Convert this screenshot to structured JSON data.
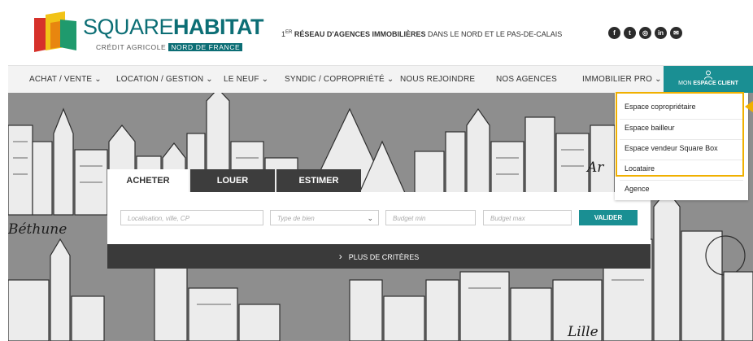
{
  "brand": {
    "name_part1": "SQUARE",
    "name_part2": "HABITAT",
    "sub_part1": "CRÉDIT AGRICOLE",
    "sub_part2": "NORD DE FRANCE"
  },
  "tagline": {
    "prefix": "1",
    "sup": "ER",
    "bold": " RÉSEAU D'AGENCES IMMOBILIÈRES",
    "rest": " DANS LE NORD ET LE PAS-DE-CALAIS"
  },
  "socials": [
    {
      "icon": "facebook-icon",
      "glyph": "f"
    },
    {
      "icon": "twitter-icon",
      "glyph": "t"
    },
    {
      "icon": "instagram-icon",
      "glyph": "◎"
    },
    {
      "icon": "linkedin-icon",
      "glyph": "in"
    },
    {
      "icon": "mail-icon",
      "glyph": "✉"
    }
  ],
  "nav": {
    "items": [
      "ACHAT / VENTE ⌄",
      "LOCATION / GESTION ⌄",
      "LE NEUF ⌄",
      "SYNDIC / COPROPRIÉTÉ ⌄",
      "NOUS REJOINDRE",
      "NOS AGENCES",
      "IMMOBILIER PRO ⌄"
    ],
    "client_prefix": "MON ",
    "client_bold": "ESPACE CLIENT"
  },
  "cities": [
    "Béthune",
    "Lille",
    "Ar"
  ],
  "search": {
    "tabs": [
      "ACHETER",
      "LOUER",
      "ESTIMER"
    ],
    "location_placeholder": "Localisation, ville, CP",
    "type_placeholder": "Type de bien",
    "budget_min_placeholder": "Budget min",
    "budget_max_placeholder": "Budget max",
    "submit_label": "VALIDER",
    "more_criteria": "PLUS DE CRITÈRES"
  },
  "dropdown": {
    "items": [
      "Espace copropriétaire",
      "Espace bailleur",
      "Espace vendeur Square Box",
      "Locataire",
      "Agence"
    ]
  },
  "colors": {
    "brand_teal": "#0c6e75",
    "accent_teal": "#1a8f93",
    "highlight": "#f0b000",
    "logo_red": "#d6312a",
    "logo_yellow": "#f2c317",
    "logo_green": "#1f9a6d"
  }
}
